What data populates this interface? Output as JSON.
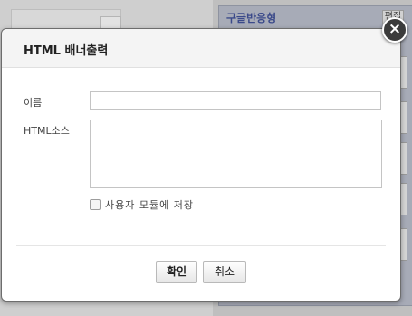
{
  "background": {
    "panel_title": "구글반응형",
    "panel_button_label": "편집"
  },
  "modal": {
    "title": "HTML 배너출력",
    "close_glyph": "×",
    "fields": {
      "name_label": "이름",
      "name_value": "",
      "source_label": "HTML소스",
      "source_value": ""
    },
    "save_module_label": "사용자 모듈에 저장",
    "save_module_checked": false,
    "buttons": {
      "confirm": "확인",
      "cancel": "취소"
    }
  }
}
